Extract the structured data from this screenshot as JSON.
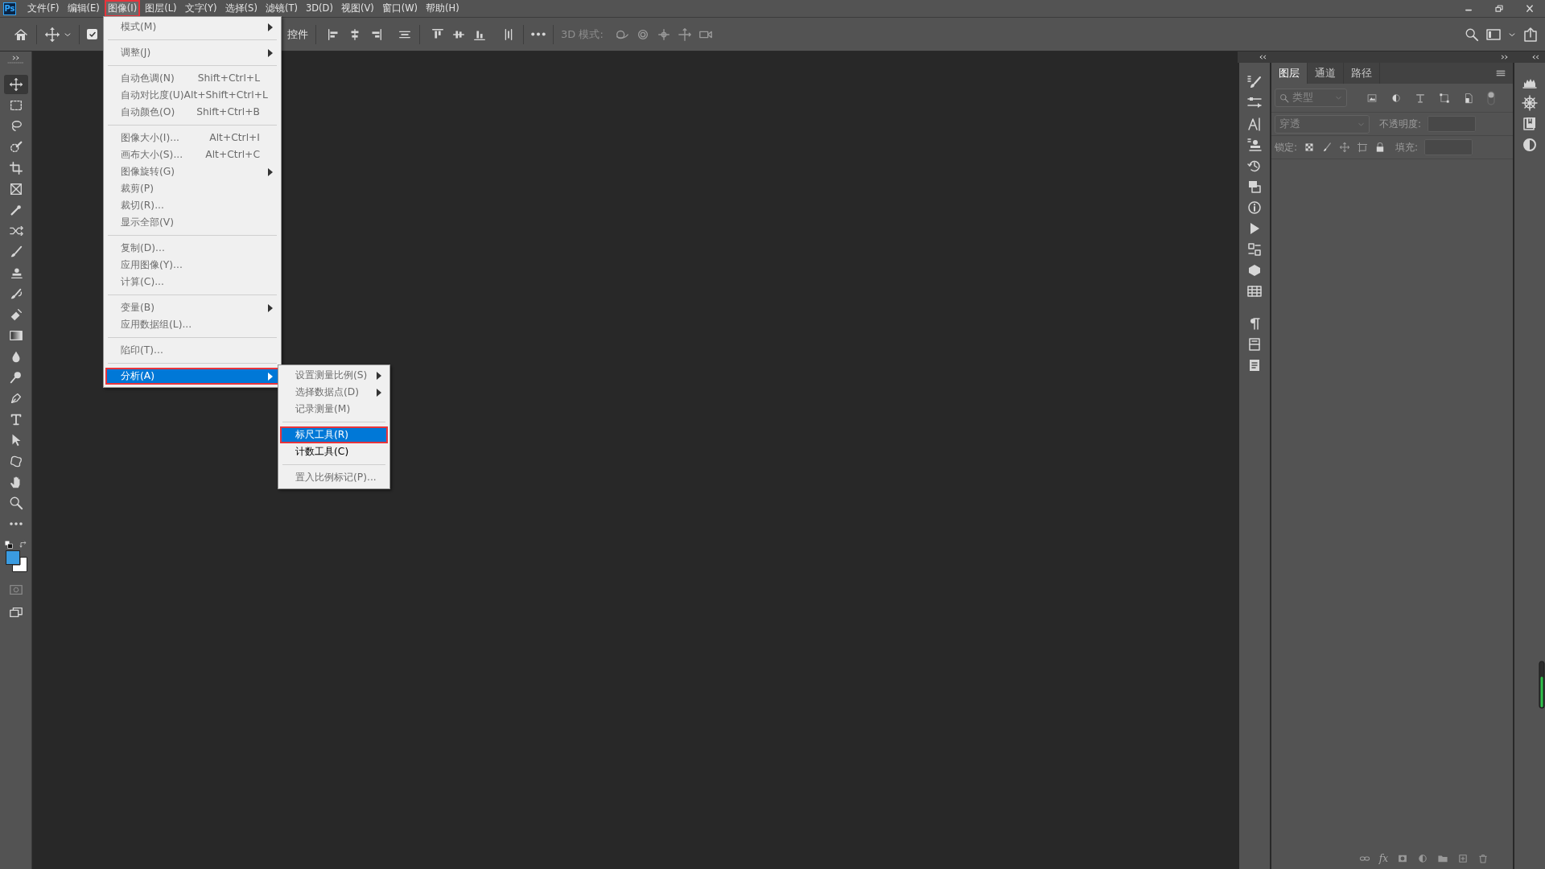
{
  "app": {
    "logo": "Ps"
  },
  "menubar": {
    "items": [
      {
        "label": "文件(F)",
        "selected": false,
        "outlined": false
      },
      {
        "label": "编辑(E)",
        "selected": false,
        "outlined": false
      },
      {
        "label": "图像(I)",
        "selected": true,
        "outlined": true
      },
      {
        "label": "图层(L)",
        "selected": false,
        "outlined": false
      },
      {
        "label": "文字(Y)",
        "selected": false,
        "outlined": false
      },
      {
        "label": "选择(S)",
        "selected": false,
        "outlined": false
      },
      {
        "label": "滤镜(T)",
        "selected": false,
        "outlined": false
      },
      {
        "label": "3D(D)",
        "selected": false,
        "outlined": false
      },
      {
        "label": "视图(V)",
        "selected": false,
        "outlined": false
      },
      {
        "label": "窗口(W)",
        "selected": false,
        "outlined": false
      },
      {
        "label": "帮助(H)",
        "selected": false,
        "outlined": false
      }
    ]
  },
  "options_bar": {
    "auto_select_checked": true,
    "controls_label": "控件",
    "mode_label": "3D 模式:"
  },
  "image_menu": {
    "items": [
      {
        "kind": "submenu",
        "label": "模式(M)",
        "disabled": true,
        "selected": false,
        "outlined": false
      },
      {
        "kind": "separator"
      },
      {
        "kind": "submenu",
        "label": "调整(J)",
        "disabled": true,
        "selected": false,
        "outlined": false
      },
      {
        "kind": "separator"
      },
      {
        "kind": "command",
        "label": "自动色调(N)",
        "shortcut": "Shift+Ctrl+L",
        "disabled": true,
        "selected": false,
        "outlined": false
      },
      {
        "kind": "command",
        "label": "自动对比度(U)",
        "shortcut": "Alt+Shift+Ctrl+L",
        "disabled": true,
        "selected": false,
        "outlined": false
      },
      {
        "kind": "command",
        "label": "自动颜色(O)",
        "shortcut": "Shift+Ctrl+B",
        "disabled": true,
        "selected": false,
        "outlined": false
      },
      {
        "kind": "separator"
      },
      {
        "kind": "command",
        "label": "图像大小(I)...",
        "shortcut": "Alt+Ctrl+I",
        "disabled": true,
        "selected": false,
        "outlined": false
      },
      {
        "kind": "command",
        "label": "画布大小(S)...",
        "shortcut": "Alt+Ctrl+C",
        "disabled": true,
        "selected": false,
        "outlined": false
      },
      {
        "kind": "submenu",
        "label": "图像旋转(G)",
        "disabled": true,
        "selected": false,
        "outlined": false
      },
      {
        "kind": "command",
        "label": "裁剪(P)",
        "disabled": true,
        "selected": false,
        "outlined": false
      },
      {
        "kind": "command",
        "label": "裁切(R)...",
        "disabled": true,
        "selected": false,
        "outlined": false
      },
      {
        "kind": "command",
        "label": "显示全部(V)",
        "disabled": true,
        "selected": false,
        "outlined": false
      },
      {
        "kind": "separator"
      },
      {
        "kind": "command",
        "label": "复制(D)...",
        "disabled": true,
        "selected": false,
        "outlined": false
      },
      {
        "kind": "command",
        "label": "应用图像(Y)...",
        "disabled": true,
        "selected": false,
        "outlined": false
      },
      {
        "kind": "command",
        "label": "计算(C)...",
        "disabled": true,
        "selected": false,
        "outlined": false
      },
      {
        "kind": "separator"
      },
      {
        "kind": "submenu",
        "label": "变量(B)",
        "disabled": true,
        "selected": false,
        "outlined": false
      },
      {
        "kind": "command",
        "label": "应用数据组(L)...",
        "disabled": true,
        "selected": false,
        "outlined": false
      },
      {
        "kind": "separator"
      },
      {
        "kind": "command",
        "label": "陷印(T)...",
        "disabled": true,
        "selected": false,
        "outlined": false
      },
      {
        "kind": "separator"
      },
      {
        "kind": "submenu",
        "label": "分析(A)",
        "disabled": false,
        "selected": true,
        "outlined": true
      }
    ]
  },
  "analysis_submenu": {
    "items": [
      {
        "kind": "submenu",
        "label": "设置测量比例(S)",
        "disabled": true,
        "selected": false,
        "outlined": false
      },
      {
        "kind": "submenu",
        "label": "选择数据点(D)",
        "disabled": true,
        "selected": false,
        "outlined": false
      },
      {
        "kind": "command",
        "label": "记录测量(M)",
        "disabled": true,
        "selected": false,
        "outlined": false
      },
      {
        "kind": "separator"
      },
      {
        "kind": "command",
        "label": "标尺工具(R)",
        "disabled": false,
        "selected": true,
        "outlined": true
      },
      {
        "kind": "command",
        "label": "计数工具(C)",
        "disabled": false,
        "selected": false,
        "outlined": false
      },
      {
        "kind": "separator"
      },
      {
        "kind": "command",
        "label": "置入比例标记(P)...",
        "disabled": true,
        "selected": false,
        "outlined": false
      }
    ]
  },
  "toolbar": {
    "tools": [
      {
        "kind": "move",
        "selected": true
      },
      {
        "kind": "marquee",
        "selected": false
      },
      {
        "kind": "lasso",
        "selected": false
      },
      {
        "kind": "quick",
        "selected": false
      },
      {
        "kind": "crop",
        "selected": false
      },
      {
        "kind": "frame",
        "selected": false
      },
      {
        "kind": "eyedropper",
        "selected": false
      },
      {
        "kind": "healing",
        "selected": false
      },
      {
        "kind": "brush",
        "selected": false
      },
      {
        "kind": "stamp",
        "selected": false
      },
      {
        "kind": "history",
        "selected": false
      },
      {
        "kind": "eraser",
        "selected": false
      },
      {
        "kind": "gradient",
        "selected": false
      },
      {
        "kind": "drop",
        "selected": false
      },
      {
        "kind": "dodge",
        "selected": false
      },
      {
        "kind": "pen",
        "selected": false
      },
      {
        "kind": "type",
        "selected": false
      },
      {
        "kind": "select",
        "selected": false
      },
      {
        "kind": "shape",
        "selected": false
      },
      {
        "kind": "hand",
        "selected": false
      },
      {
        "kind": "zoom",
        "selected": false
      },
      {
        "kind": "more",
        "selected": false
      }
    ],
    "foreground": {
      "color": "#3a9be0"
    },
    "background": {
      "color": "#ffffff"
    }
  },
  "layers_panel": {
    "tabs": [
      {
        "label": "图层",
        "selected": true
      },
      {
        "label": "通道",
        "selected": false
      },
      {
        "label": "路径",
        "selected": false
      }
    ],
    "filter": {
      "value": "类型"
    },
    "blend_mode": {
      "value": "穿透"
    },
    "opacity_label": "不透明度:",
    "lock_label": "锁定:",
    "fill_label": "填充:",
    "effects_button": "fx"
  }
}
